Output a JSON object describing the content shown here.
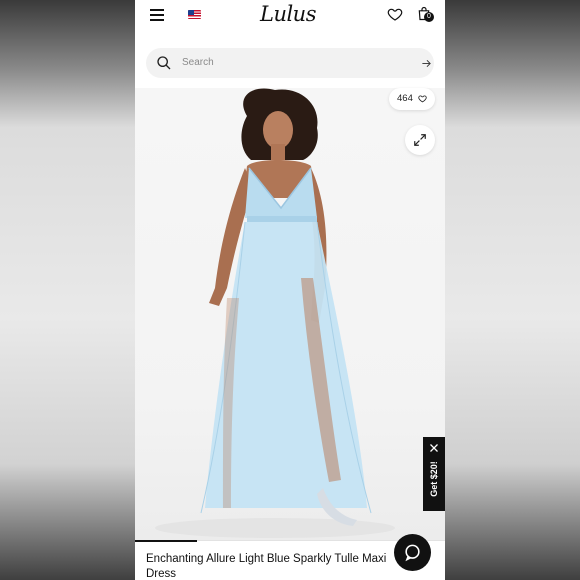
{
  "header": {
    "logo": "Lulus",
    "cart_count": "0"
  },
  "search": {
    "placeholder": "Search"
  },
  "product": {
    "like_count": "464",
    "name": "Enchanting Allure Light Blue Sparkly Tulle Maxi Dress",
    "image_progress": 0.2
  },
  "promo": {
    "label": "Get $20!"
  },
  "icons": {
    "menu": "hamburger-icon",
    "flag": "us-flag-icon",
    "wishlist": "heart-icon",
    "cart": "shopping-bag-icon",
    "search": "search-icon",
    "submit": "arrow-right-icon",
    "expand": "expand-icon",
    "close": "close-icon",
    "chat": "chat-icon"
  },
  "colors": {
    "accent": "#111111",
    "dress": "#bfe0f0",
    "background": "#f4f4f4"
  }
}
